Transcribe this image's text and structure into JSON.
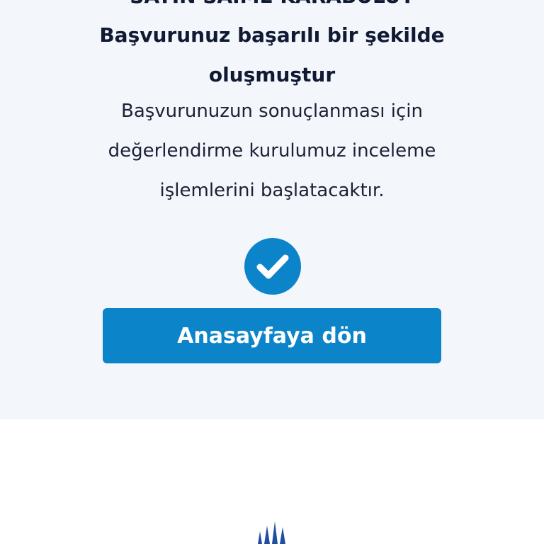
{
  "page": {
    "greeting": "SAYIN SAIME KARABULUT",
    "headline_line1": "Başvurunuz başarılı bir şekilde",
    "headline_line2": "oluşmuştur",
    "body_line1": "Başvurunuzun sonuçlanması için",
    "body_line2": "değerlendirme kurulumuz inceleme",
    "body_line3": "işlemlerini başlatacaktır.",
    "home_button_label": "Anasayfaya dön"
  },
  "icons": {
    "success": "check-circle-icon",
    "footer_logo": "brand-logo"
  },
  "colors": {
    "accent": "#0b84c9",
    "card_background": "#f3f6fb",
    "text_dark": "#101a33"
  }
}
